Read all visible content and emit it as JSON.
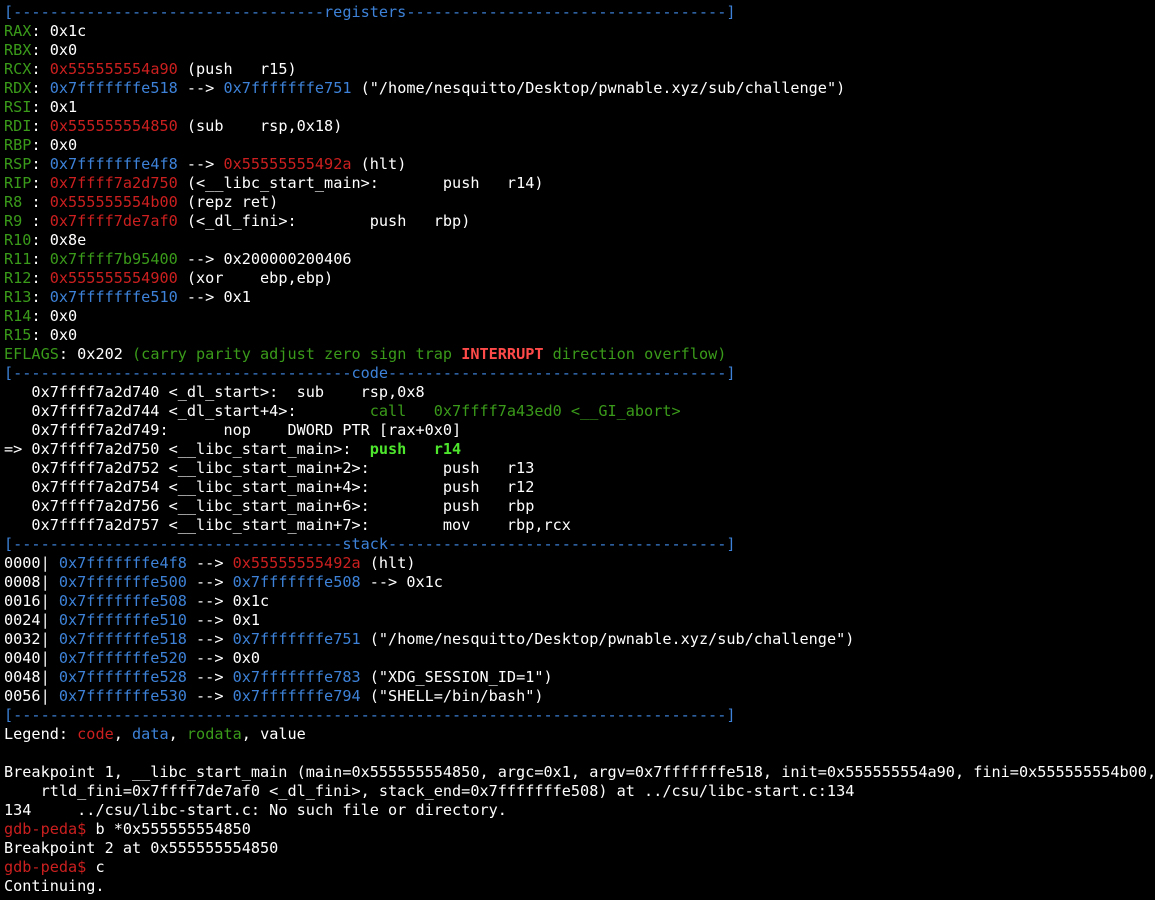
{
  "colors": {
    "code": "#cc1f1f",
    "data": "#3d82d8",
    "rodata": "#3a9a1a",
    "value": "#ffffff",
    "current": "#4ee62d",
    "flag_set": "#ff4a4a"
  },
  "registers": {
    "header": "[----------------------------------registers-----------------------------------]",
    "lines": [
      [
        {
          "t": "RAX",
          "c": "green"
        },
        {
          "t": ": 0x1c",
          "c": "white"
        }
      ],
      [
        {
          "t": "RBX",
          "c": "green"
        },
        {
          "t": ": 0x0",
          "c": "white"
        }
      ],
      [
        {
          "t": "RCX",
          "c": "green"
        },
        {
          "t": ": ",
          "c": "white"
        },
        {
          "t": "0x555555554a90",
          "c": "red"
        },
        {
          "t": " (push   r15)",
          "c": "white"
        }
      ],
      [
        {
          "t": "RDX",
          "c": "green"
        },
        {
          "t": ": ",
          "c": "white"
        },
        {
          "t": "0x7fffffffe518",
          "c": "blue"
        },
        {
          "t": " --> ",
          "c": "white"
        },
        {
          "t": "0x7fffffffe751",
          "c": "blue"
        },
        {
          "t": " (\"/home/nesquitto/Desktop/pwnable.xyz/sub/challenge\")",
          "c": "white"
        }
      ],
      [
        {
          "t": "RSI",
          "c": "green"
        },
        {
          "t": ": 0x1",
          "c": "white"
        }
      ],
      [
        {
          "t": "RDI",
          "c": "green"
        },
        {
          "t": ": ",
          "c": "white"
        },
        {
          "t": "0x555555554850",
          "c": "red"
        },
        {
          "t": " (sub    rsp,0x18)",
          "c": "white"
        }
      ],
      [
        {
          "t": "RBP",
          "c": "green"
        },
        {
          "t": ": 0x0",
          "c": "white"
        }
      ],
      [
        {
          "t": "RSP",
          "c": "green"
        },
        {
          "t": ": ",
          "c": "white"
        },
        {
          "t": "0x7fffffffe4f8",
          "c": "blue"
        },
        {
          "t": " --> ",
          "c": "white"
        },
        {
          "t": "0x55555555492a",
          "c": "red"
        },
        {
          "t": " (hlt)",
          "c": "white"
        }
      ],
      [
        {
          "t": "RIP",
          "c": "green"
        },
        {
          "t": ": ",
          "c": "white"
        },
        {
          "t": "0x7ffff7a2d750",
          "c": "red"
        },
        {
          "t": " (<__libc_start_main>:       push   r14)",
          "c": "white"
        }
      ],
      [
        {
          "t": "R8 ",
          "c": "green"
        },
        {
          "t": ": ",
          "c": "white"
        },
        {
          "t": "0x555555554b00",
          "c": "red"
        },
        {
          "t": " (repz ret)",
          "c": "white"
        }
      ],
      [
        {
          "t": "R9 ",
          "c": "green"
        },
        {
          "t": ": ",
          "c": "white"
        },
        {
          "t": "0x7ffff7de7af0",
          "c": "red"
        },
        {
          "t": " (<_dl_fini>:        push   rbp)",
          "c": "white"
        }
      ],
      [
        {
          "t": "R10",
          "c": "green"
        },
        {
          "t": ": 0x8e",
          "c": "white"
        }
      ],
      [
        {
          "t": "R11",
          "c": "green"
        },
        {
          "t": ": ",
          "c": "white"
        },
        {
          "t": "0x7ffff7b95400",
          "c": "green"
        },
        {
          "t": " --> 0x200000200406",
          "c": "white"
        }
      ],
      [
        {
          "t": "R12",
          "c": "green"
        },
        {
          "t": ": ",
          "c": "white"
        },
        {
          "t": "0x555555554900",
          "c": "red"
        },
        {
          "t": " (xor    ebp,ebp)",
          "c": "white"
        }
      ],
      [
        {
          "t": "R13",
          "c": "green"
        },
        {
          "t": ": ",
          "c": "white"
        },
        {
          "t": "0x7fffffffe510",
          "c": "blue"
        },
        {
          "t": " --> 0x1",
          "c": "white"
        }
      ],
      [
        {
          "t": "R14",
          "c": "green"
        },
        {
          "t": ": 0x0",
          "c": "white"
        }
      ],
      [
        {
          "t": "R15",
          "c": "green"
        },
        {
          "t": ": 0x0",
          "c": "white"
        }
      ],
      [
        {
          "t": "EFLAGS",
          "c": "green"
        },
        {
          "t": ": 0x202 ",
          "c": "white"
        },
        {
          "t": "(carry parity adjust zero sign trap ",
          "c": "green"
        },
        {
          "t": "INTERRUPT",
          "c": "bred"
        },
        {
          "t": " direction overflow)",
          "c": "green"
        }
      ]
    ]
  },
  "code": {
    "header": "[-------------------------------------code-------------------------------------]",
    "lines": [
      [
        {
          "t": "   0x7ffff7a2d740 <_dl_start>:  sub    rsp,0x8",
          "c": "white"
        }
      ],
      [
        {
          "t": "   0x7ffff7a2d744 <_dl_start+4>:        ",
          "c": "white"
        },
        {
          "t": "call   0x7ffff7a43ed0 <__GI_abort>",
          "c": "green"
        }
      ],
      [
        {
          "t": "   0x7ffff7a2d749:      nop    DWORD PTR [rax+0x0]",
          "c": "white"
        }
      ],
      [
        {
          "t": "=> 0x7ffff7a2d750 <__libc_start_main>:  ",
          "c": "white"
        },
        {
          "t": "push   r14",
          "c": "bgreen"
        }
      ],
      [
        {
          "t": "   0x7ffff7a2d752 <__libc_start_main+2>:        push   r13",
          "c": "white"
        }
      ],
      [
        {
          "t": "   0x7ffff7a2d754 <__libc_start_main+4>:        push   r12",
          "c": "white"
        }
      ],
      [
        {
          "t": "   0x7ffff7a2d756 <__libc_start_main+6>:        push   rbp",
          "c": "white"
        }
      ],
      [
        {
          "t": "   0x7ffff7a2d757 <__libc_start_main+7>:        mov    rbp,rcx",
          "c": "white"
        }
      ]
    ]
  },
  "stack": {
    "header": "[------------------------------------stack-------------------------------------]",
    "lines": [
      [
        {
          "t": "0000| ",
          "c": "white"
        },
        {
          "t": "0x7fffffffe4f8",
          "c": "blue"
        },
        {
          "t": " --> ",
          "c": "white"
        },
        {
          "t": "0x55555555492a",
          "c": "red"
        },
        {
          "t": " (hlt)",
          "c": "white"
        }
      ],
      [
        {
          "t": "0008| ",
          "c": "white"
        },
        {
          "t": "0x7fffffffe500",
          "c": "blue"
        },
        {
          "t": " --> ",
          "c": "white"
        },
        {
          "t": "0x7fffffffe508",
          "c": "blue"
        },
        {
          "t": " --> 0x1c",
          "c": "white"
        }
      ],
      [
        {
          "t": "0016| ",
          "c": "white"
        },
        {
          "t": "0x7fffffffe508",
          "c": "blue"
        },
        {
          "t": " --> 0x1c",
          "c": "white"
        }
      ],
      [
        {
          "t": "0024| ",
          "c": "white"
        },
        {
          "t": "0x7fffffffe510",
          "c": "blue"
        },
        {
          "t": " --> 0x1",
          "c": "white"
        }
      ],
      [
        {
          "t": "0032| ",
          "c": "white"
        },
        {
          "t": "0x7fffffffe518",
          "c": "blue"
        },
        {
          "t": " --> ",
          "c": "white"
        },
        {
          "t": "0x7fffffffe751",
          "c": "blue"
        },
        {
          "t": " (\"/home/nesquitto/Desktop/pwnable.xyz/sub/challenge\")",
          "c": "white"
        }
      ],
      [
        {
          "t": "0040| ",
          "c": "white"
        },
        {
          "t": "0x7fffffffe520",
          "c": "blue"
        },
        {
          "t": " --> 0x0",
          "c": "white"
        }
      ],
      [
        {
          "t": "0048| ",
          "c": "white"
        },
        {
          "t": "0x7fffffffe528",
          "c": "blue"
        },
        {
          "t": " --> ",
          "c": "white"
        },
        {
          "t": "0x7fffffffe783",
          "c": "blue"
        },
        {
          "t": " (\"XDG_SESSION_ID=1\")",
          "c": "white"
        }
      ],
      [
        {
          "t": "0056| ",
          "c": "white"
        },
        {
          "t": "0x7fffffffe530",
          "c": "blue"
        },
        {
          "t": " --> ",
          "c": "white"
        },
        {
          "t": "0x7fffffffe794",
          "c": "blue"
        },
        {
          "t": " (\"SHELL=/bin/bash\")",
          "c": "white"
        }
      ]
    ]
  },
  "footer_rule": "[------------------------------------------------------------------------------]",
  "legend": [
    {
      "t": "Legend: ",
      "c": "white"
    },
    {
      "t": "code",
      "c": "red"
    },
    {
      "t": ", ",
      "c": "white"
    },
    {
      "t": "data",
      "c": "blue"
    },
    {
      "t": ", ",
      "c": "white"
    },
    {
      "t": "rodata",
      "c": "green"
    },
    {
      "t": ", value",
      "c": "white"
    }
  ],
  "output": {
    "breakpoint1_line1": "Breakpoint 1, __libc_start_main (main=0x555555554850, argc=0x1, argv=0x7fffffffe518, init=0x555555554a90, fini=0x555555554b00,",
    "breakpoint1_line2": "    rtld_fini=0x7ffff7de7af0 <_dl_fini>, stack_end=0x7fffffffe508) at ../csu/libc-start.c:134",
    "source_line": "134\t../csu/libc-start.c: No such file or directory.",
    "prompt1": "gdb-peda$ ",
    "cmd1": "b *0x555555554850",
    "breakpoint2": "Breakpoint 2 at 0x555555554850",
    "prompt2": "gdb-peda$ ",
    "cmd2": "c",
    "continuing": "Continuing."
  }
}
